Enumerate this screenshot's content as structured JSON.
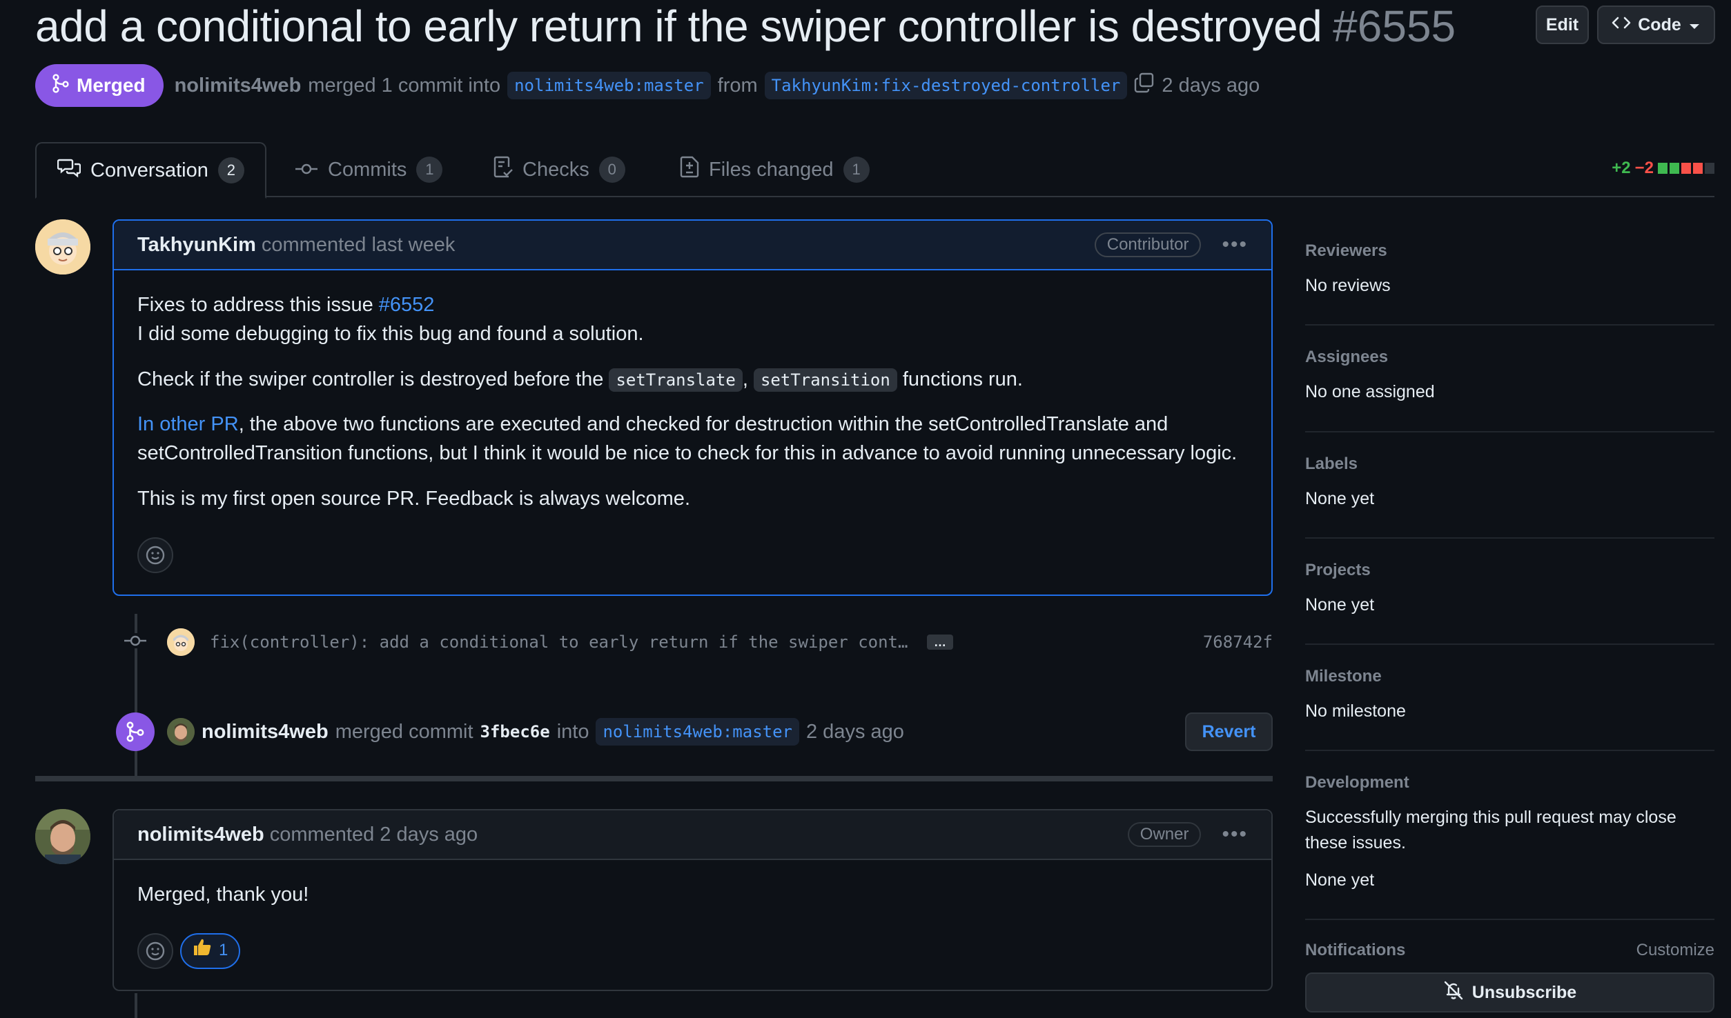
{
  "pr": {
    "title": "add a conditional to early return if the swiper controller is destroyed",
    "number": "#6555",
    "state": "Merged",
    "merger": "nolimits4web",
    "merge_phrase": "merged 1 commit into",
    "base_branch": "nolimits4web:master",
    "from_word": "from",
    "head_branch": "TakhyunKim:fix-destroyed-controller",
    "time": "2 days ago"
  },
  "header_buttons": {
    "edit": "Edit",
    "code": "Code"
  },
  "tabs": [
    {
      "label": "Conversation",
      "count": "2",
      "icon": "comment-discussion-icon"
    },
    {
      "label": "Commits",
      "count": "1",
      "icon": "git-commit-icon"
    },
    {
      "label": "Checks",
      "count": "0",
      "icon": "checklist-icon"
    },
    {
      "label": "Files changed",
      "count": "1",
      "icon": "file-diff-icon"
    }
  ],
  "diffstat": {
    "additions": "+2",
    "deletions": "−2",
    "colors": [
      "#3fb950",
      "#3fb950",
      "#f85149",
      "#f85149",
      "#30363d"
    ]
  },
  "comment1": {
    "author": "TakhyunKim",
    "action": "commented last week",
    "role": "Contributor",
    "line1_text": "Fixes to address this issue ",
    "line1_link": "#6552",
    "line2": "I did some debugging to fix this bug and found a solution.",
    "p2_pre": "Check if the swiper controller is destroyed before the ",
    "p2_code1": "setTranslate",
    "p2_sep": ", ",
    "p2_code2": "setTransition",
    "p2_post": " functions run.",
    "p3_link": "In other PR",
    "p3_text": ", the above two functions are executed and checked for destruction within the setControlledTranslate and setControlledTransition functions, but I think it would be nice to check for this in advance to avoid running unnecessary logic.",
    "p4": "This is my first open source PR. Feedback is always welcome."
  },
  "commit": {
    "message": "fix(controller): add a conditional to early return if the swiper cont…",
    "ellipsis": "…",
    "sha": "768742f"
  },
  "merge_event": {
    "actor": "nolimits4web",
    "phrase": "merged commit",
    "sha": "3fbec6e",
    "into": "into",
    "branch": "nolimits4web:master",
    "time": "2 days ago",
    "revert": "Revert"
  },
  "comment2": {
    "author": "nolimits4web",
    "action": "commented 2 days ago",
    "role": "Owner",
    "body": "Merged, thank you!",
    "reaction_count": "1"
  },
  "sidebar": {
    "reviewers_title": "Reviewers",
    "reviewers_value": "No reviews",
    "assignees_title": "Assignees",
    "assignees_value": "No one assigned",
    "labels_title": "Labels",
    "labels_value": "None yet",
    "projects_title": "Projects",
    "projects_value": "None yet",
    "milestone_title": "Milestone",
    "milestone_value": "No milestone",
    "development_title": "Development",
    "development_text": "Successfully merging this pull request may close these issues.",
    "development_value": "None yet",
    "notifications_title": "Notifications",
    "customize": "Customize",
    "unsubscribe": "Unsubscribe"
  }
}
